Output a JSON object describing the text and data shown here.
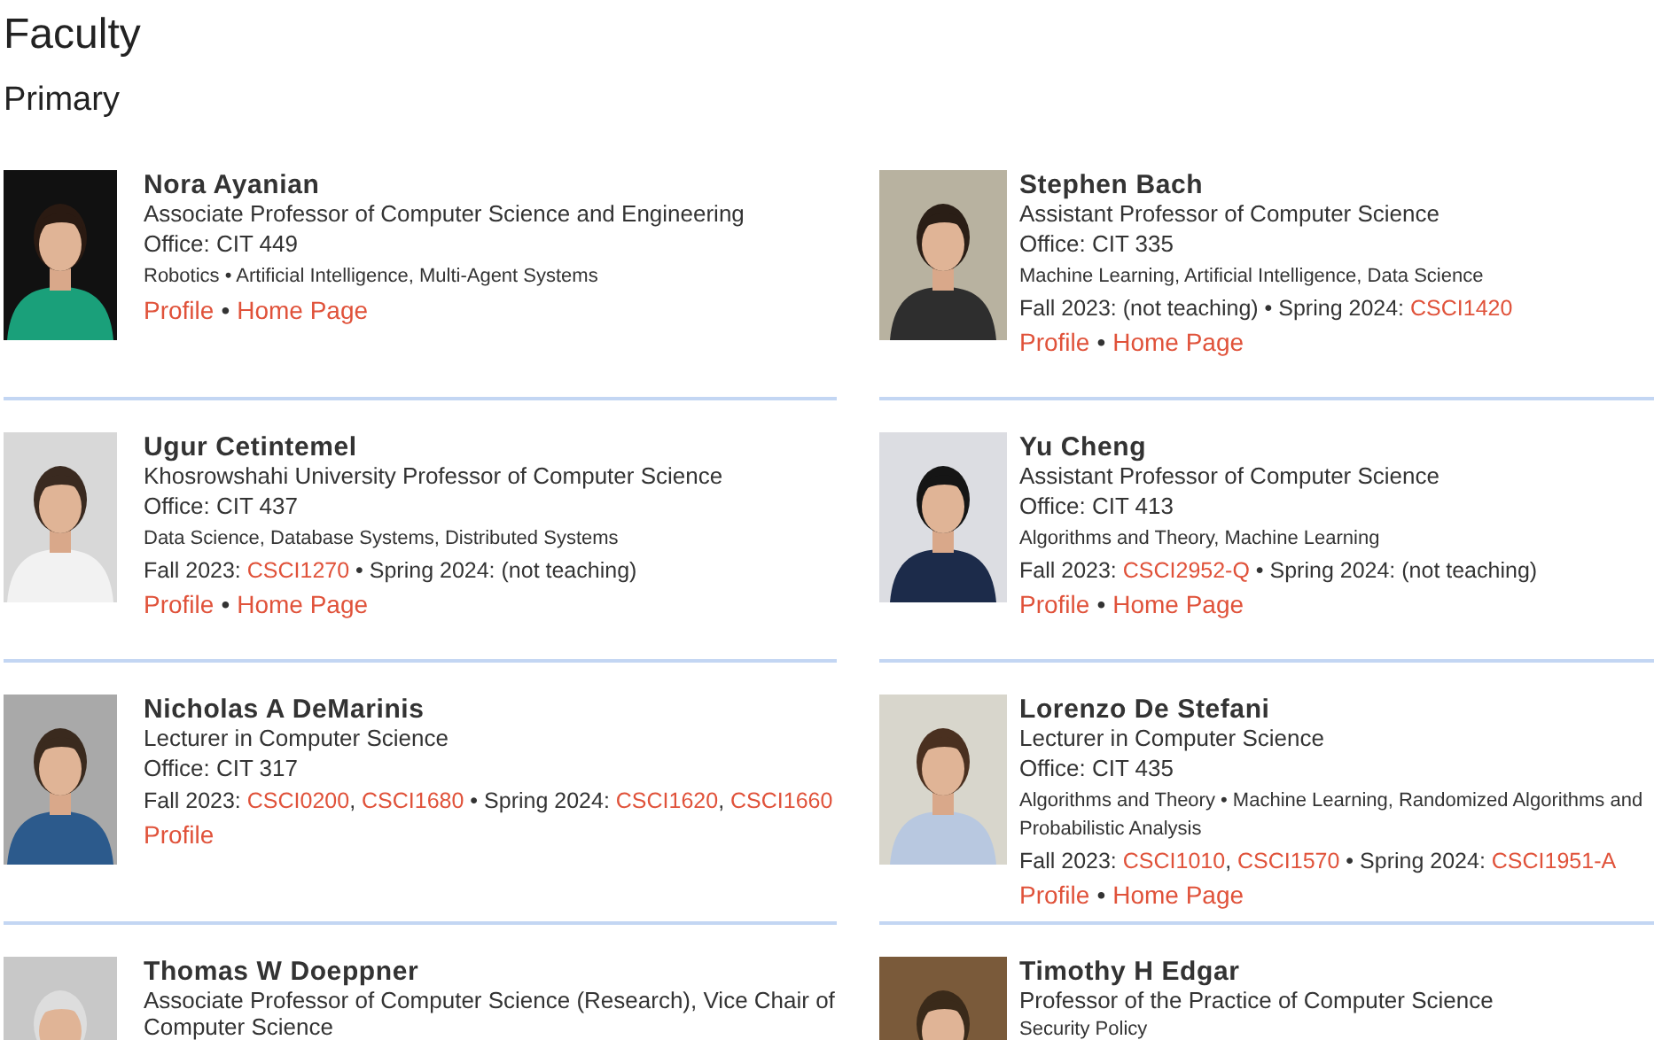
{
  "heading": "Faculty",
  "subheading": "Primary",
  "separator": "•",
  "comma": ",",
  "faculty": [
    {
      "name": "Nora Ayanian",
      "title": "Associate Professor of Computer Science and Engineering",
      "office": "Office: CIT 449",
      "areas": "Robotics • Artificial Intelligence, Multi-Agent Systems",
      "photo": {
        "kind": "picture"
      },
      "links": [
        "Profile",
        "Home Page"
      ]
    },
    {
      "name": "Stephen Bach",
      "title": "Assistant Professor of Computer Science",
      "office": "Office: CIT 335",
      "areas": "Machine Learning, Artificial Intelligence, Data Science",
      "photo": {
        "kind": "picture"
      },
      "teaching": [
        {
          "label": "Fall 2023:",
          "note": "(not teaching)"
        },
        {
          "label": "Spring 2024:",
          "courses": [
            "CSCI1420"
          ]
        }
      ],
      "links": [
        "Profile",
        "Home Page"
      ]
    },
    {
      "name": "Ugur Cetintemel",
      "title": "Khosrowshahi University Professor of Computer Science",
      "office": "Office: CIT 437",
      "areas": "Data Science, Database Systems, Distributed Systems",
      "photo": {
        "kind": "picture"
      },
      "teaching": [
        {
          "label": "Fall 2023:",
          "courses": [
            "CSCI1270"
          ]
        },
        {
          "label": "Spring 2024:",
          "note": "(not teaching)"
        }
      ],
      "links": [
        "Profile",
        "Home Page"
      ]
    },
    {
      "name": "Yu Cheng",
      "title": "Assistant Professor of Computer Science",
      "office": "Office: CIT 413",
      "areas": "Algorithms and Theory, Machine Learning",
      "photo": {
        "kind": "picture"
      },
      "teaching": [
        {
          "label": "Fall 2023:",
          "courses": [
            "CSCI2952-Q"
          ]
        },
        {
          "label": "Spring 2024:",
          "note": "(not teaching)"
        }
      ],
      "links": [
        "Profile",
        "Home Page"
      ]
    },
    {
      "name": "Nicholas A DeMarinis",
      "title": "Lecturer in Computer Science",
      "office": "Office: CIT 317",
      "photo": {
        "kind": "picture"
      },
      "teaching": [
        {
          "label": "Fall 2023:",
          "courses": [
            "CSCI0200",
            "CSCI1680"
          ]
        },
        {
          "label": "Spring 2024:",
          "courses": [
            "CSCI1620",
            "CSCI1660"
          ]
        }
      ],
      "links": [
        "Profile"
      ]
    },
    {
      "name": "Lorenzo De Stefani",
      "title": "Lecturer in Computer Science",
      "office": "Office: CIT 435",
      "areas": "Algorithms and Theory • Machine Learning, Randomized Algorithms and Probabilistic Analysis",
      "photo": {
        "kind": "picture"
      },
      "teaching": [
        {
          "label": "Fall 2023:",
          "courses": [
            "CSCI1010",
            "CSCI1570"
          ]
        },
        {
          "label": "Spring 2024:",
          "courses": [
            "CSCI1951-A"
          ]
        }
      ],
      "links": [
        "Profile",
        "Home Page"
      ]
    },
    {
      "name": "Thomas W Doeppner",
      "title": "Associate Professor of Computer Science (Research), Vice Chair of Computer Science",
      "photo": {
        "kind": "picture"
      }
    },
    {
      "name": "Timothy H Edgar",
      "title": "Professor of the Practice of Computer Science",
      "areas": "Security Policy",
      "photo": {
        "kind": "picture"
      }
    }
  ]
}
